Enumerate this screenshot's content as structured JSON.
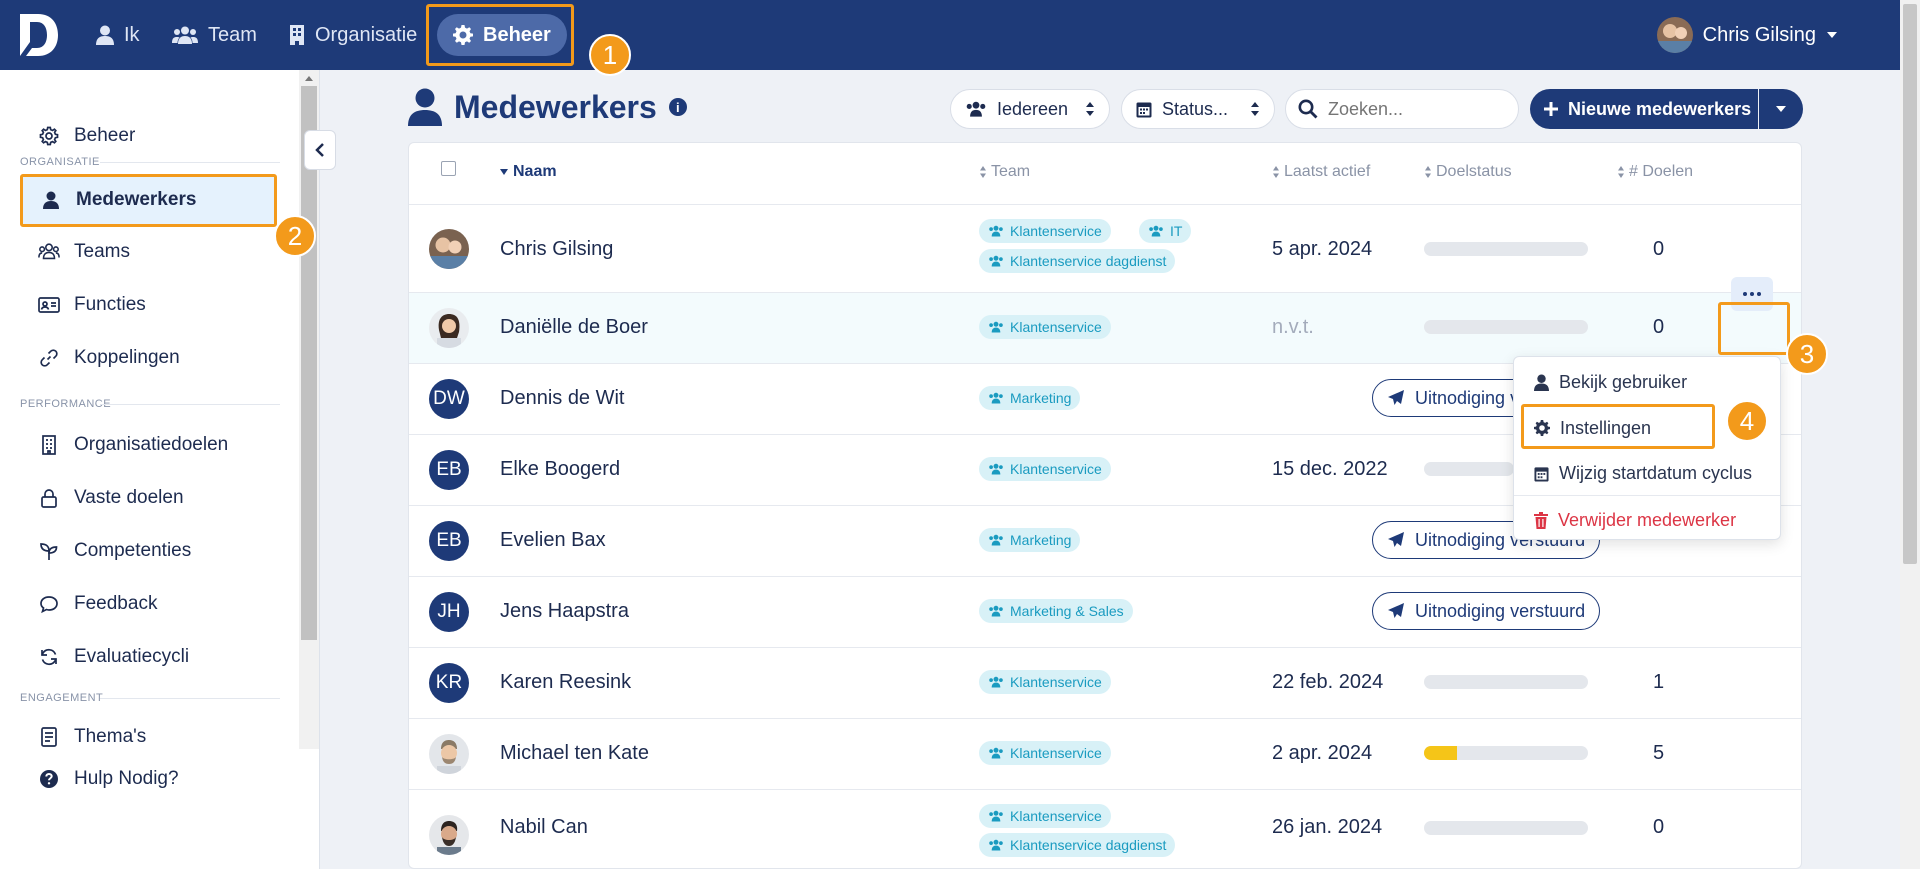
{
  "topbar": {
    "nav": [
      {
        "label": "Ik",
        "icon": "user-icon"
      },
      {
        "label": "Team",
        "icon": "users-icon"
      },
      {
        "label": "Organisatie",
        "icon": "building-icon"
      },
      {
        "label": "Beheer",
        "icon": "gear-icon",
        "active": true
      }
    ],
    "user_name": "Chris Gilsing"
  },
  "annotations": [
    "1",
    "2",
    "3",
    "4"
  ],
  "sidebar": {
    "beheer_label": "Beheer",
    "sections": {
      "organisatie": "ORGANISATIE",
      "performance": "PERFORMANCE",
      "engagement": "ENGAGEMENT"
    },
    "items": {
      "medewerkers": "Medewerkers",
      "teams": "Teams",
      "functies": "Functies",
      "koppelingen": "Koppelingen",
      "organisatiedoelen": "Organisatiedoelen",
      "vaste_doelen": "Vaste doelen",
      "competenties": "Competenties",
      "feedback": "Feedback",
      "evaluatiecycli": "Evaluatiecycli",
      "themas": "Thema's",
      "hulp": "Hulp Nodig?"
    }
  },
  "page": {
    "title": "Medewerkers",
    "info": "i",
    "filter_everyone": "Iedereen",
    "filter_status": "Status...",
    "search_placeholder": "Zoeken...",
    "new_button": "Nieuwe medewerkers"
  },
  "table": {
    "headers": {
      "name": "Naam",
      "team": "Team",
      "last_active": "Laatst actief",
      "goal_status": "Doelstatus",
      "goals": "# Doelen"
    },
    "rows": [
      {
        "name": "Chris Gilsing",
        "avatar": "photo",
        "tags": [
          "Klantenservice",
          "IT",
          "Klantenservice dagdienst"
        ],
        "last_active": "5 apr. 2024",
        "progress": 0,
        "goals": "0"
      },
      {
        "name": "Daniëlle de Boer",
        "avatar": "photo",
        "tags": [
          "Klantenservice"
        ],
        "last_active": "n.v.t.",
        "progress": 0,
        "goals": "0"
      },
      {
        "name": "Dennis de Wit",
        "initials": "DW",
        "tags": [
          "Marketing"
        ],
        "invite": "Uitnodiging v"
      },
      {
        "name": "Elke Boogerd",
        "initials": "EB",
        "tags": [
          "Klantenservice"
        ],
        "last_active": "15 dec. 2022"
      },
      {
        "name": "Evelien Bax",
        "initials": "EB",
        "tags": [
          "Marketing"
        ],
        "invite": "Uitnodiging verstuurd"
      },
      {
        "name": "Jens Haapstra",
        "initials": "JH",
        "tags": [
          "Marketing & Sales"
        ],
        "invite": "Uitnodiging verstuurd"
      },
      {
        "name": "Karen Reesink",
        "initials": "KR",
        "tags": [
          "Klantenservice"
        ],
        "last_active": "22 feb. 2024",
        "progress": 0,
        "goals": "1"
      },
      {
        "name": "Michael ten Kate",
        "avatar": "photo",
        "tags": [
          "Klantenservice"
        ],
        "last_active": "2 apr. 2024",
        "progress": 0.2,
        "goals": "5"
      },
      {
        "name": "Nabil Can",
        "avatar": "photo",
        "tags": [
          "Klantenservice",
          "Klantenservice dagdienst"
        ],
        "last_active": "26 jan. 2024",
        "progress": 0,
        "goals": "0"
      }
    ]
  },
  "row_menu": {
    "view_user": "Bekijk gebruiker",
    "settings": "Instellingen",
    "change_cycle": "Wijzig startdatum cyclus",
    "delete": "Verwijder medewerker"
  },
  "colors": {
    "primary": "#1e3a78",
    "accent": "#f39a1b",
    "tag_bg": "#d8f1f7",
    "tag_text": "#1a9bc0",
    "danger": "#dc3545",
    "progress": "#f5c518"
  }
}
